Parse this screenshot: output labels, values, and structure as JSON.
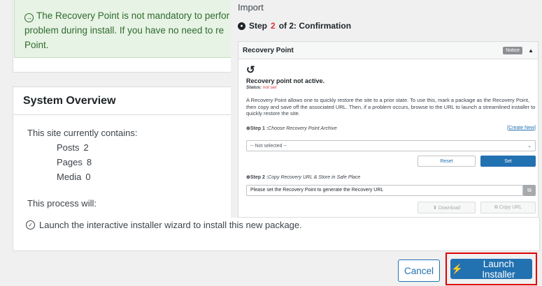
{
  "top_notice": {
    "line1": "The Recovery Point is not mandatory to perfor",
    "line2": "problem during install. If you have no need to re",
    "line3": "Point."
  },
  "system_overview": {
    "title": "System Overview",
    "contains_label": "This site currently contains:",
    "stats": [
      {
        "label": "Posts",
        "value": "2"
      },
      {
        "label": "Pages",
        "value": "8"
      },
      {
        "label": "Media",
        "value": "0"
      }
    ],
    "process_label": "This process will:",
    "launch_text": "Launch the interactive installer wizard to install this new package."
  },
  "footer": {
    "cancel_label": "Cancel",
    "launch_label": "Launch Installer"
  },
  "import_panel": {
    "title": "Import",
    "step_prefix": "Step",
    "step_current": "2",
    "step_suffix": "of 2: Confirmation",
    "recovery": {
      "title": "Recovery Point",
      "badge": "Notice",
      "status_title": "Recovery point not active.",
      "status_label": "Status:",
      "status_value": "not set",
      "description": "A Recovery Point allows one to quickly restore the site to a prior state. To use this, mark a package as the Recovery Point, then copy and save off the associated URL. Then, if a problem occurs, browse to the URL to launch a streamlined installer to quickly restore the site.",
      "step1_label": "Step 1 :",
      "step1_desc": "Choose Recovery Point Archive",
      "create_new": "[Create New]",
      "select_value": "-- Not selected --",
      "reset_label": "Reset",
      "set_label": "Set",
      "step2_label": "Step 2 :",
      "step2_desc": "Copy Recovery URL & Store in Safe Place",
      "url_value": "Please set the Recovery Point to generate the Recovery URL",
      "download_label": "Download",
      "copy_url_label": "Copy URL"
    }
  }
}
